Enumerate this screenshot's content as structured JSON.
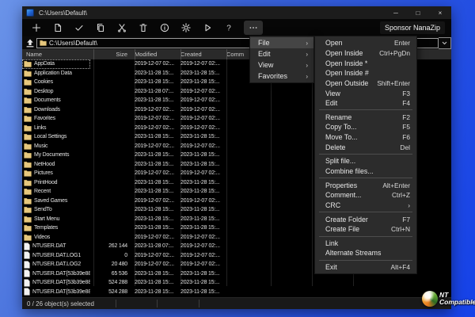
{
  "window": {
    "title": "C:\\Users\\Default\\",
    "controls": {
      "minimize": "─",
      "maximize": "□",
      "close": "×"
    }
  },
  "toolbar": {
    "buttons": [
      {
        "name": "add"
      },
      {
        "name": "extract"
      },
      {
        "name": "test"
      },
      {
        "name": "copy"
      },
      {
        "name": "move"
      },
      {
        "name": "delete"
      },
      {
        "name": "info"
      },
      {
        "name": "options"
      },
      {
        "name": "run"
      },
      {
        "name": "help"
      },
      {
        "name": "more",
        "active": true
      }
    ],
    "sponsor_label": "Sponsor NanaZip"
  },
  "addressbar": {
    "path": "C:\\Users\\Default\\"
  },
  "columns": [
    "Name",
    "Size",
    "Modified",
    "Created",
    "Comm"
  ],
  "files": [
    {
      "name": "AppData",
      "type": "folder",
      "size": "",
      "modified": "2019-12-07 02:...",
      "created": "2019-12-07 02:...",
      "focused": true
    },
    {
      "name": "Application Data",
      "type": "folder",
      "size": "",
      "modified": "2023-11-28 15:...",
      "created": "2023-11-28 15:..."
    },
    {
      "name": "Cookies",
      "type": "folder",
      "size": "",
      "modified": "2023-11-28 15:...",
      "created": "2023-11-28 15:..."
    },
    {
      "name": "Desktop",
      "type": "folder",
      "size": "",
      "modified": "2023-11-28 07:...",
      "created": "2019-12-07 02:..."
    },
    {
      "name": "Documents",
      "type": "folder",
      "size": "",
      "modified": "2023-11-28 15:...",
      "created": "2019-12-07 02:..."
    },
    {
      "name": "Downloads",
      "type": "folder",
      "size": "",
      "modified": "2019-12-07 02:...",
      "created": "2019-12-07 02:..."
    },
    {
      "name": "Favorites",
      "type": "folder",
      "size": "",
      "modified": "2019-12-07 02:...",
      "created": "2019-12-07 02:..."
    },
    {
      "name": "Links",
      "type": "folder",
      "size": "",
      "modified": "2019-12-07 02:...",
      "created": "2019-12-07 02:..."
    },
    {
      "name": "Local Settings",
      "type": "folder",
      "size": "",
      "modified": "2023-11-28 15:...",
      "created": "2023-11-28 15:..."
    },
    {
      "name": "Music",
      "type": "folder",
      "size": "",
      "modified": "2019-12-07 02:...",
      "created": "2019-12-07 02:..."
    },
    {
      "name": "My Documents",
      "type": "folder",
      "size": "",
      "modified": "2023-11-28 15:...",
      "created": "2023-11-28 15:..."
    },
    {
      "name": "NetHood",
      "type": "folder",
      "size": "",
      "modified": "2023-11-28 15:...",
      "created": "2023-11-28 15:..."
    },
    {
      "name": "Pictures",
      "type": "folder",
      "size": "",
      "modified": "2019-12-07 02:...",
      "created": "2019-12-07 02:..."
    },
    {
      "name": "PrintHood",
      "type": "folder",
      "size": "",
      "modified": "2023-11-28 15:...",
      "created": "2023-11-28 15:..."
    },
    {
      "name": "Recent",
      "type": "folder",
      "size": "",
      "modified": "2023-11-28 15:...",
      "created": "2023-11-28 15:..."
    },
    {
      "name": "Saved Games",
      "type": "folder",
      "size": "",
      "modified": "2019-12-07 02:...",
      "created": "2019-12-07 02:..."
    },
    {
      "name": "SendTo",
      "type": "folder",
      "size": "",
      "modified": "2023-11-28 15:...",
      "created": "2023-11-28 15:..."
    },
    {
      "name": "Start Menu",
      "type": "folder",
      "size": "",
      "modified": "2023-11-28 15:...",
      "created": "2023-11-28 15:..."
    },
    {
      "name": "Templates",
      "type": "folder",
      "size": "",
      "modified": "2023-11-28 15:...",
      "created": "2023-11-28 15:..."
    },
    {
      "name": "Videos",
      "type": "folder",
      "size": "",
      "modified": "2019-12-07 02:...",
      "created": "2019-12-07 02:..."
    },
    {
      "name": "NTUSER.DAT",
      "type": "file",
      "size": "262 144",
      "modified": "2023-11-28 07:...",
      "created": "2019-12-07 02:..."
    },
    {
      "name": "NTUSER.DAT.LOG1",
      "type": "file",
      "size": "0",
      "modified": "2019-12-07 02:...",
      "created": "2019-12-07 02:..."
    },
    {
      "name": "NTUSER.DAT.LOG2",
      "type": "file",
      "size": "20 480",
      "modified": "2019-12-07 02:...",
      "created": "2019-12-07 02:..."
    },
    {
      "name": "NTUSER.DAT{53b39e88-...",
      "type": "file",
      "size": "65 536",
      "modified": "2023-11-28 15:...",
      "created": "2023-11-28 15:..."
    },
    {
      "name": "NTUSER.DAT{53b39e88-...",
      "type": "file",
      "size": "524 288",
      "modified": "2023-11-28 15:...",
      "created": "2023-11-28 15:..."
    },
    {
      "name": "NTUSER.DAT{53b39e88-...",
      "type": "file",
      "size": "524 288",
      "modified": "2023-11-28 15:...",
      "created": "2023-11-28 15:..."
    }
  ],
  "menubar": {
    "items": [
      {
        "label": "File",
        "highlighted": true
      },
      {
        "label": "Edit"
      },
      {
        "label": "View"
      },
      {
        "label": "Favorites"
      }
    ]
  },
  "file_menu": {
    "items": [
      {
        "label": "Open",
        "shortcut": "Enter"
      },
      {
        "label": "Open Inside",
        "shortcut": "Ctrl+PgDn"
      },
      {
        "label": "Open Inside *",
        "shortcut": ""
      },
      {
        "label": "Open Inside #",
        "shortcut": ""
      },
      {
        "label": "Open Outside",
        "shortcut": "Shift+Enter"
      },
      {
        "label": "View",
        "shortcut": "F3"
      },
      {
        "label": "Edit",
        "shortcut": "F4"
      },
      {
        "separator": true
      },
      {
        "label": "Rename",
        "shortcut": "F2"
      },
      {
        "label": "Copy To...",
        "shortcut": "F5"
      },
      {
        "label": "Move To...",
        "shortcut": "F6"
      },
      {
        "label": "Delete",
        "shortcut": "Del"
      },
      {
        "separator": true
      },
      {
        "label": "Split file...",
        "shortcut": ""
      },
      {
        "label": "Combine files...",
        "shortcut": ""
      },
      {
        "separator": true
      },
      {
        "label": "Properties",
        "shortcut": "Alt+Enter"
      },
      {
        "label": "Comment...",
        "shortcut": "Ctrl+Z"
      },
      {
        "label": "CRC",
        "shortcut": "›",
        "submenu": true
      },
      {
        "separator": true
      },
      {
        "label": "Create Folder",
        "shortcut": "F7"
      },
      {
        "label": "Create File",
        "shortcut": "Ctrl+N"
      },
      {
        "separator": true
      },
      {
        "label": "Link",
        "shortcut": ""
      },
      {
        "label": "Alternate Streams",
        "shortcut": ""
      },
      {
        "separator": true
      },
      {
        "label": "Exit",
        "shortcut": "Alt+F4"
      }
    ]
  },
  "statusbar": {
    "text": "0 / 26 object(s) selected"
  },
  "watermark": {
    "line1": "NT",
    "line2": "Compatible"
  },
  "colors": {
    "desktop_gradient_start": "#6a93e8",
    "desktop_gradient_end": "#1541e8",
    "window_bg": "#0a0a0a",
    "titlebar_bg": "#1c1c1c",
    "header_bg": "#2a2a2a",
    "menu_bg": "#2c2c2c",
    "menu_highlight": "#454545",
    "folder_icon": "#e6c77d",
    "file_icon": "#f2f2f2",
    "text": "#e6e6e6"
  }
}
